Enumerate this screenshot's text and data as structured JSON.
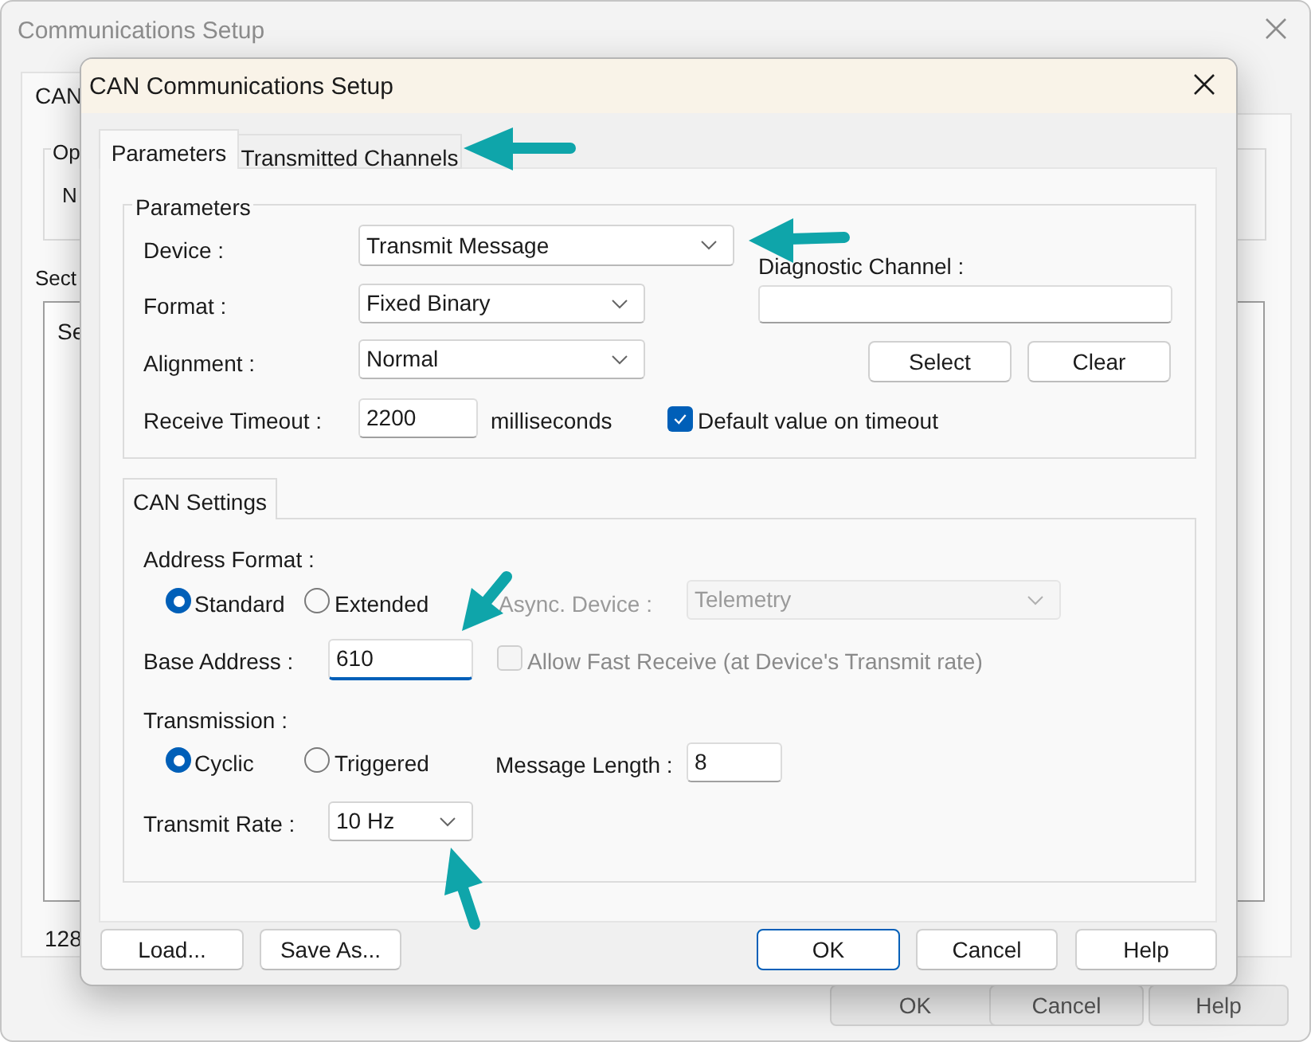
{
  "background_window": {
    "title": "Communications Setup",
    "tab": "CAN",
    "group_label": "Op",
    "group_text": "N",
    "section_label": "Sect",
    "list_text": "Se",
    "footer_text": "128",
    "buttons": [
      "OK",
      "Cancel",
      "Help"
    ]
  },
  "dialog": {
    "title": "CAN Communications Setup",
    "tabs": [
      {
        "label": "Parameters",
        "selected": true
      },
      {
        "label": "Transmitted Channels",
        "selected": false
      }
    ],
    "parameters": {
      "title": "Parameters",
      "device": {
        "label": "Device :",
        "value": "Transmit Message"
      },
      "format": {
        "label": "Format :",
        "value": "Fixed Binary"
      },
      "alignment": {
        "label": "Alignment :",
        "value": "Normal"
      },
      "receive_timeout": {
        "label": "Receive Timeout :",
        "value": "2200",
        "unit": "milliseconds"
      },
      "default_on_timeout": {
        "label": "Default value on timeout",
        "checked": true
      },
      "diagnostic_channel": {
        "label": "Diagnostic Channel :"
      },
      "buttons": [
        "Select",
        "Clear"
      ]
    },
    "can_settings": {
      "tab": "CAN Settings",
      "address_format": {
        "label": "Address Format :",
        "options": [
          {
            "label": "Standard",
            "selected": true
          },
          {
            "label": "Extended",
            "selected": false
          }
        ]
      },
      "async_device": {
        "label": "Async. Device :",
        "value": "Telemetry",
        "disabled": true
      },
      "base_address": {
        "label": "Base Address :",
        "value": "610",
        "focused": true
      },
      "allow_fast_receive": {
        "label": "Allow Fast Receive (at Device's Transmit rate)",
        "checked": false,
        "disabled": true
      },
      "transmission": {
        "label": "Transmission :",
        "options": [
          {
            "label": "Cyclic",
            "selected": true
          },
          {
            "label": "Triggered",
            "selected": false
          }
        ]
      },
      "message_length": {
        "label": "Message Length :",
        "value": "8"
      },
      "transmit_rate": {
        "label": "Transmit Rate :",
        "value": "10 Hz"
      }
    },
    "buttons": [
      {
        "label": "Load...",
        "default": false
      },
      {
        "label": "Save As...",
        "default": false
      },
      {
        "label": "OK",
        "default": true
      },
      {
        "label": "Cancel",
        "default": false
      },
      {
        "label": "Help",
        "default": false
      }
    ]
  },
  "annotations": [
    {
      "kind": "arrow"
    },
    {
      "kind": "arrow"
    },
    {
      "kind": "arrow"
    },
    {
      "kind": "arrow"
    }
  ]
}
